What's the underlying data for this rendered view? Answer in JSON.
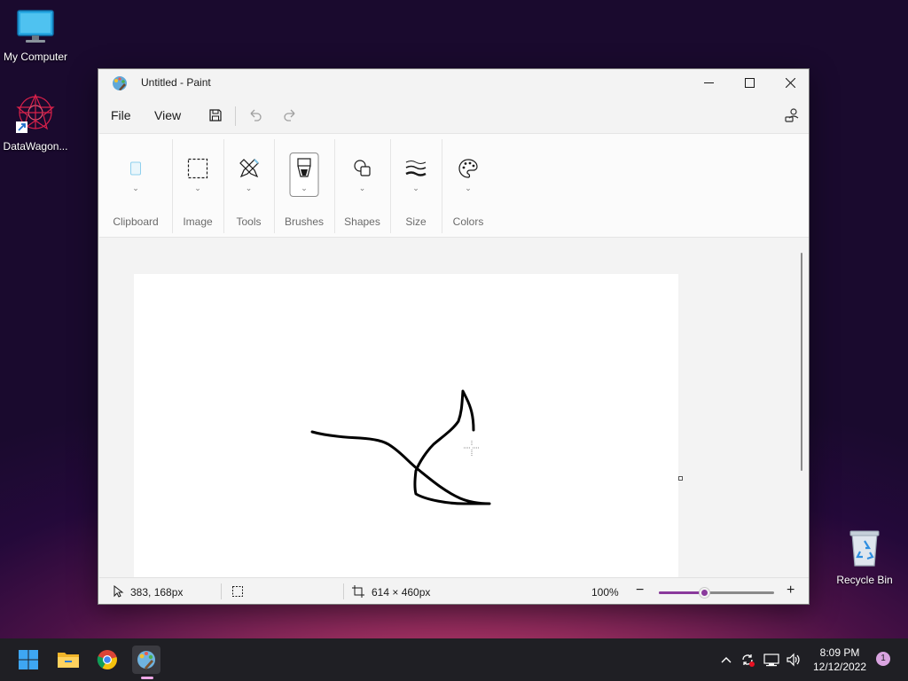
{
  "desktop": {
    "icons": [
      {
        "label": "My Computer",
        "icon": "monitor-icon"
      },
      {
        "label": "DataWagon...",
        "icon": "datawagon-app-icon"
      },
      {
        "label": "Recycle Bin",
        "icon": "recycle-bin-icon"
      }
    ]
  },
  "window": {
    "title": "Untitled - Paint",
    "menu": {
      "file": "File",
      "view": "View"
    },
    "toolbar_icons": [
      "save-icon",
      "undo-icon",
      "redo-icon",
      "account-icon"
    ],
    "ribbon": {
      "groups": [
        {
          "label": "Clipboard",
          "icon": "clipboard-icon"
        },
        {
          "label": "Image",
          "icon": "selection-icon"
        },
        {
          "label": "Tools",
          "icon": "pencil-tools-icon"
        },
        {
          "label": "Brushes",
          "icon": "brush-icon"
        },
        {
          "label": "Shapes",
          "icon": "shapes-icon"
        },
        {
          "label": "Size",
          "icon": "line-size-icon"
        },
        {
          "label": "Colors",
          "icon": "palette-icon"
        }
      ]
    },
    "status": {
      "cursor_position": "383, 168px",
      "canvas_size": "614 × 460px",
      "zoom": "100%",
      "zoom_fraction": 0.39
    }
  },
  "taskbar": {
    "apps": [
      "start-icon",
      "file-explorer-icon",
      "chrome-icon",
      "paint-icon"
    ],
    "clock_time": "8:09 PM",
    "clock_date": "12/12/2022",
    "notification_count": "1"
  },
  "colors": {
    "accent": "#8a3a9c",
    "taskbar_bg": "#1f1f24",
    "window_bg": "#f3f3f3"
  }
}
